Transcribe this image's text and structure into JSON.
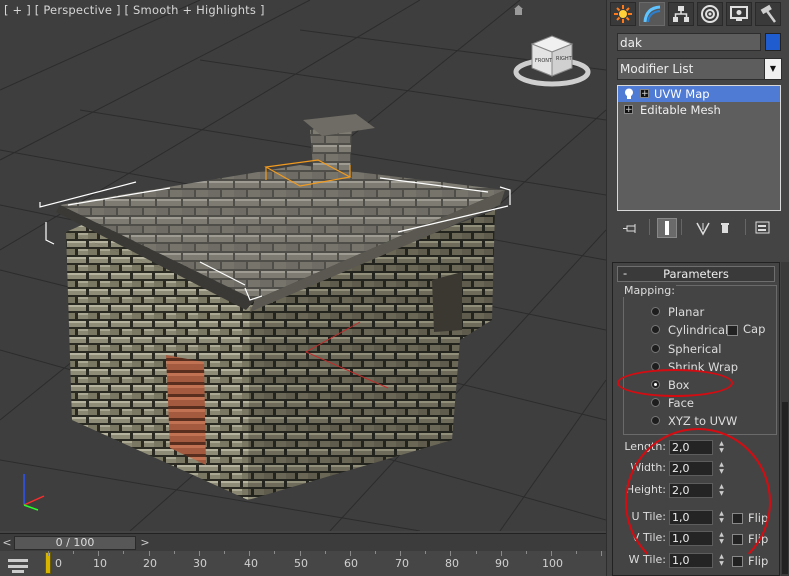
{
  "viewport": {
    "label": "[ + ] [ Perspective ] [ Smooth + Highlights ]",
    "viewcube_front": "FRONT",
    "viewcube_right": "RIGHT"
  },
  "command_panel": {
    "tabs": [
      "create-tab",
      "modify-tab",
      "hierarchy-tab",
      "motion-tab",
      "display-tab",
      "utilities-tab"
    ],
    "active_tab": "modify-tab",
    "object_name": "dak",
    "object_color": "#1f5ccf",
    "modifier_list": "Modifier List",
    "stack": [
      {
        "label": "UVW Map",
        "selected": true
      },
      {
        "label": "Editable Mesh",
        "selected": false
      }
    ],
    "stack_tools": [
      "pin-stack-icon",
      "show-end-result-icon",
      "make-unique-icon",
      "remove-modifier-icon",
      "configure-sets-icon"
    ]
  },
  "parameters": {
    "rollout_minus": "-",
    "rollout_title": "Parameters",
    "mapping_title": "Mapping:",
    "mapping_options": [
      "Planar",
      "Cylindrical",
      "Spherical",
      "Shrink Wrap",
      "Box",
      "Face",
      "XYZ to UVW"
    ],
    "selected_mapping": "Box",
    "cap_label": "Cap",
    "length_label": "Length:",
    "length_value": "2,0",
    "width_label": "Width:",
    "width_value": "2,0",
    "height_label": "Height:",
    "height_value": "2,0",
    "u_tile_label": "U Tile:",
    "u_tile_value": "1,0",
    "v_tile_label": "V Tile:",
    "v_tile_value": "1,0",
    "w_tile_label": "W Tile:",
    "w_tile_value": "1,0",
    "flip_label": "Flip"
  },
  "timeline": {
    "prev": "<",
    "next": ">",
    "frame_display": "0 / 100",
    "ticks": [
      "0",
      "10",
      "20",
      "30",
      "40",
      "50",
      "60",
      "70",
      "80",
      "90",
      "100"
    ]
  },
  "annotation_color": "#d40c12"
}
